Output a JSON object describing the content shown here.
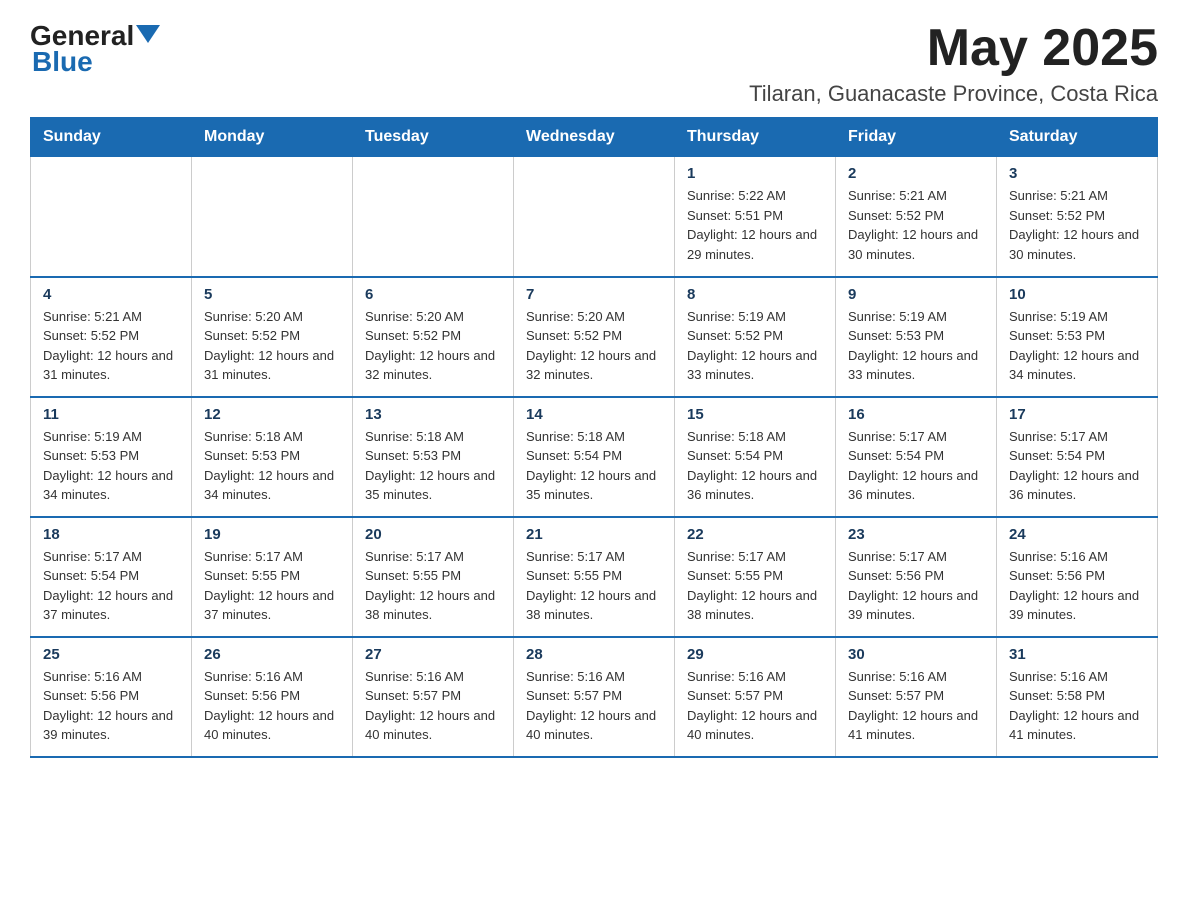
{
  "header": {
    "logo_general": "General",
    "logo_blue": "Blue",
    "month_year": "May 2025",
    "location": "Tilaran, Guanacaste Province, Costa Rica"
  },
  "weekdays": [
    "Sunday",
    "Monday",
    "Tuesday",
    "Wednesday",
    "Thursday",
    "Friday",
    "Saturday"
  ],
  "weeks": [
    [
      {
        "day": "",
        "info": ""
      },
      {
        "day": "",
        "info": ""
      },
      {
        "day": "",
        "info": ""
      },
      {
        "day": "",
        "info": ""
      },
      {
        "day": "1",
        "info": "Sunrise: 5:22 AM\nSunset: 5:51 PM\nDaylight: 12 hours and 29 minutes."
      },
      {
        "day": "2",
        "info": "Sunrise: 5:21 AM\nSunset: 5:52 PM\nDaylight: 12 hours and 30 minutes."
      },
      {
        "day": "3",
        "info": "Sunrise: 5:21 AM\nSunset: 5:52 PM\nDaylight: 12 hours and 30 minutes."
      }
    ],
    [
      {
        "day": "4",
        "info": "Sunrise: 5:21 AM\nSunset: 5:52 PM\nDaylight: 12 hours and 31 minutes."
      },
      {
        "day": "5",
        "info": "Sunrise: 5:20 AM\nSunset: 5:52 PM\nDaylight: 12 hours and 31 minutes."
      },
      {
        "day": "6",
        "info": "Sunrise: 5:20 AM\nSunset: 5:52 PM\nDaylight: 12 hours and 32 minutes."
      },
      {
        "day": "7",
        "info": "Sunrise: 5:20 AM\nSunset: 5:52 PM\nDaylight: 12 hours and 32 minutes."
      },
      {
        "day": "8",
        "info": "Sunrise: 5:19 AM\nSunset: 5:52 PM\nDaylight: 12 hours and 33 minutes."
      },
      {
        "day": "9",
        "info": "Sunrise: 5:19 AM\nSunset: 5:53 PM\nDaylight: 12 hours and 33 minutes."
      },
      {
        "day": "10",
        "info": "Sunrise: 5:19 AM\nSunset: 5:53 PM\nDaylight: 12 hours and 34 minutes."
      }
    ],
    [
      {
        "day": "11",
        "info": "Sunrise: 5:19 AM\nSunset: 5:53 PM\nDaylight: 12 hours and 34 minutes."
      },
      {
        "day": "12",
        "info": "Sunrise: 5:18 AM\nSunset: 5:53 PM\nDaylight: 12 hours and 34 minutes."
      },
      {
        "day": "13",
        "info": "Sunrise: 5:18 AM\nSunset: 5:53 PM\nDaylight: 12 hours and 35 minutes."
      },
      {
        "day": "14",
        "info": "Sunrise: 5:18 AM\nSunset: 5:54 PM\nDaylight: 12 hours and 35 minutes."
      },
      {
        "day": "15",
        "info": "Sunrise: 5:18 AM\nSunset: 5:54 PM\nDaylight: 12 hours and 36 minutes."
      },
      {
        "day": "16",
        "info": "Sunrise: 5:17 AM\nSunset: 5:54 PM\nDaylight: 12 hours and 36 minutes."
      },
      {
        "day": "17",
        "info": "Sunrise: 5:17 AM\nSunset: 5:54 PM\nDaylight: 12 hours and 36 minutes."
      }
    ],
    [
      {
        "day": "18",
        "info": "Sunrise: 5:17 AM\nSunset: 5:54 PM\nDaylight: 12 hours and 37 minutes."
      },
      {
        "day": "19",
        "info": "Sunrise: 5:17 AM\nSunset: 5:55 PM\nDaylight: 12 hours and 37 minutes."
      },
      {
        "day": "20",
        "info": "Sunrise: 5:17 AM\nSunset: 5:55 PM\nDaylight: 12 hours and 38 minutes."
      },
      {
        "day": "21",
        "info": "Sunrise: 5:17 AM\nSunset: 5:55 PM\nDaylight: 12 hours and 38 minutes."
      },
      {
        "day": "22",
        "info": "Sunrise: 5:17 AM\nSunset: 5:55 PM\nDaylight: 12 hours and 38 minutes."
      },
      {
        "day": "23",
        "info": "Sunrise: 5:17 AM\nSunset: 5:56 PM\nDaylight: 12 hours and 39 minutes."
      },
      {
        "day": "24",
        "info": "Sunrise: 5:16 AM\nSunset: 5:56 PM\nDaylight: 12 hours and 39 minutes."
      }
    ],
    [
      {
        "day": "25",
        "info": "Sunrise: 5:16 AM\nSunset: 5:56 PM\nDaylight: 12 hours and 39 minutes."
      },
      {
        "day": "26",
        "info": "Sunrise: 5:16 AM\nSunset: 5:56 PM\nDaylight: 12 hours and 40 minutes."
      },
      {
        "day": "27",
        "info": "Sunrise: 5:16 AM\nSunset: 5:57 PM\nDaylight: 12 hours and 40 minutes."
      },
      {
        "day": "28",
        "info": "Sunrise: 5:16 AM\nSunset: 5:57 PM\nDaylight: 12 hours and 40 minutes."
      },
      {
        "day": "29",
        "info": "Sunrise: 5:16 AM\nSunset: 5:57 PM\nDaylight: 12 hours and 40 minutes."
      },
      {
        "day": "30",
        "info": "Sunrise: 5:16 AM\nSunset: 5:57 PM\nDaylight: 12 hours and 41 minutes."
      },
      {
        "day": "31",
        "info": "Sunrise: 5:16 AM\nSunset: 5:58 PM\nDaylight: 12 hours and 41 minutes."
      }
    ]
  ]
}
